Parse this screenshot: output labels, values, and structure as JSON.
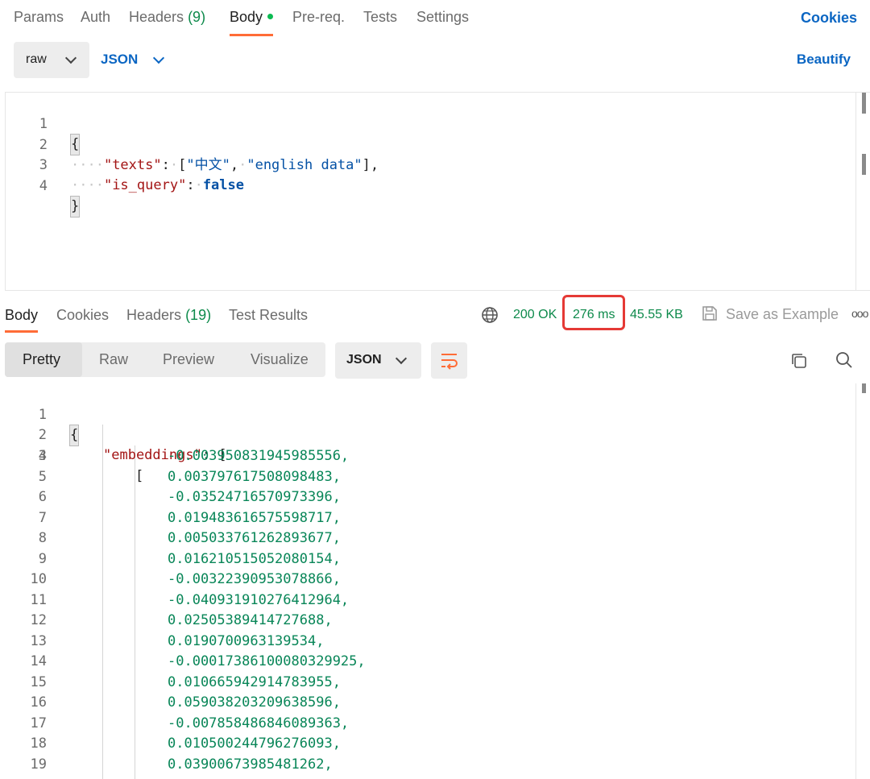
{
  "request_tabs": {
    "params": "Params",
    "auth": "Auth",
    "headers": "Headers",
    "headers_count": "(9)",
    "body": "Body",
    "prereq": "Pre-req.",
    "tests": "Tests",
    "settings": "Settings",
    "cookies": "Cookies"
  },
  "body_mode": {
    "raw": "raw",
    "json": "JSON",
    "beautify": "Beautify"
  },
  "request_body": {
    "line_numbers": [
      "1",
      "2",
      "3",
      "4"
    ],
    "open_brace": "{",
    "close_brace": "}",
    "texts_key": "\"texts\"",
    "texts_values": [
      "\"中文\"",
      "\"english data\""
    ],
    "is_query_key": "\"is_query\"",
    "is_query_value": "false"
  },
  "response_tabs": {
    "body": "Body",
    "cookies": "Cookies",
    "headers": "Headers",
    "headers_count": "(19)",
    "test_results": "Test Results"
  },
  "response_meta": {
    "status": "200 OK",
    "time": "276 ms",
    "size": "45.55 KB",
    "save_example": "Save as Example",
    "more": "ooo"
  },
  "response_view": {
    "pretty": "Pretty",
    "raw": "Raw",
    "preview": "Preview",
    "visualize": "Visualize",
    "format": "JSON"
  },
  "response_body": {
    "line_numbers": [
      "1",
      "2",
      "3",
      "4",
      "5",
      "6",
      "7",
      "8",
      "9",
      "10",
      "11",
      "12",
      "13",
      "14",
      "15",
      "16",
      "17",
      "18",
      "19"
    ],
    "open_brace": "{",
    "embeddings_key": "\"embeddings\"",
    "open_bracket": "[",
    "values": [
      "-0.003950831945985556,",
      "0.003797617508098483,",
      "-0.03524716570973396,",
      "0.019483616575598717,",
      "0.005033761262893677,",
      "0.016210515052080154,",
      "-0.00322390953078866,",
      "-0.040931910276412964,",
      "0.02505389414727688,",
      "0.0190700963139534,",
      "-0.00017386100080329925,",
      "0.010665942914783955,",
      "0.059038203209638596,",
      "-0.007858486846089363,",
      "0.010500244796276093,",
      "0.03900673985481262,"
    ]
  },
  "colors": {
    "accent_orange": "#ff6c37",
    "link_blue": "#0b66c3",
    "status_green": "#0d8a4b",
    "highlight_red": "#e53935"
  }
}
